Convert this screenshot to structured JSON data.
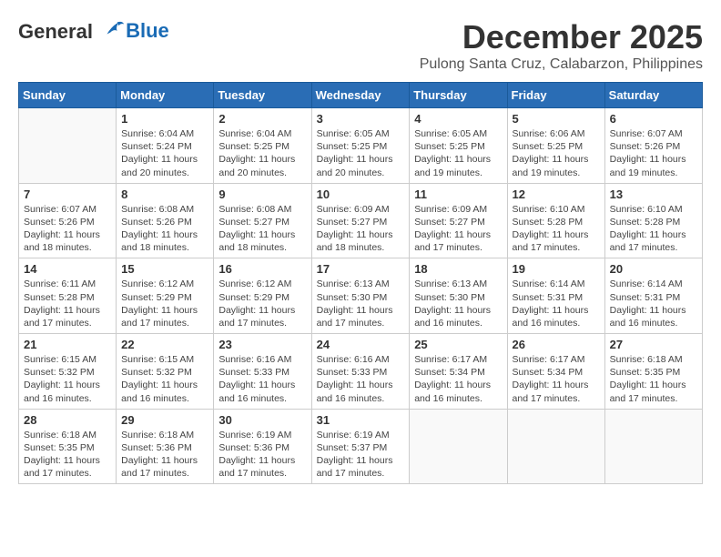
{
  "header": {
    "logo_general": "General",
    "logo_blue": "Blue",
    "month": "December 2025",
    "location": "Pulong Santa Cruz, Calabarzon, Philippines"
  },
  "days_of_week": [
    "Sunday",
    "Monday",
    "Tuesday",
    "Wednesday",
    "Thursday",
    "Friday",
    "Saturday"
  ],
  "weeks": [
    [
      {
        "day": "",
        "sunrise": "",
        "sunset": "",
        "daylight": ""
      },
      {
        "day": "1",
        "sunrise": "6:04 AM",
        "sunset": "5:24 PM",
        "daylight": "11 hours and 20 minutes."
      },
      {
        "day": "2",
        "sunrise": "6:04 AM",
        "sunset": "5:25 PM",
        "daylight": "11 hours and 20 minutes."
      },
      {
        "day": "3",
        "sunrise": "6:05 AM",
        "sunset": "5:25 PM",
        "daylight": "11 hours and 20 minutes."
      },
      {
        "day": "4",
        "sunrise": "6:05 AM",
        "sunset": "5:25 PM",
        "daylight": "11 hours and 19 minutes."
      },
      {
        "day": "5",
        "sunrise": "6:06 AM",
        "sunset": "5:25 PM",
        "daylight": "11 hours and 19 minutes."
      },
      {
        "day": "6",
        "sunrise": "6:07 AM",
        "sunset": "5:26 PM",
        "daylight": "11 hours and 19 minutes."
      }
    ],
    [
      {
        "day": "7",
        "sunrise": "6:07 AM",
        "sunset": "5:26 PM",
        "daylight": "11 hours and 18 minutes."
      },
      {
        "day": "8",
        "sunrise": "6:08 AM",
        "sunset": "5:26 PM",
        "daylight": "11 hours and 18 minutes."
      },
      {
        "day": "9",
        "sunrise": "6:08 AM",
        "sunset": "5:27 PM",
        "daylight": "11 hours and 18 minutes."
      },
      {
        "day": "10",
        "sunrise": "6:09 AM",
        "sunset": "5:27 PM",
        "daylight": "11 hours and 18 minutes."
      },
      {
        "day": "11",
        "sunrise": "6:09 AM",
        "sunset": "5:27 PM",
        "daylight": "11 hours and 17 minutes."
      },
      {
        "day": "12",
        "sunrise": "6:10 AM",
        "sunset": "5:28 PM",
        "daylight": "11 hours and 17 minutes."
      },
      {
        "day": "13",
        "sunrise": "6:10 AM",
        "sunset": "5:28 PM",
        "daylight": "11 hours and 17 minutes."
      }
    ],
    [
      {
        "day": "14",
        "sunrise": "6:11 AM",
        "sunset": "5:28 PM",
        "daylight": "11 hours and 17 minutes."
      },
      {
        "day": "15",
        "sunrise": "6:12 AM",
        "sunset": "5:29 PM",
        "daylight": "11 hours and 17 minutes."
      },
      {
        "day": "16",
        "sunrise": "6:12 AM",
        "sunset": "5:29 PM",
        "daylight": "11 hours and 17 minutes."
      },
      {
        "day": "17",
        "sunrise": "6:13 AM",
        "sunset": "5:30 PM",
        "daylight": "11 hours and 17 minutes."
      },
      {
        "day": "18",
        "sunrise": "6:13 AM",
        "sunset": "5:30 PM",
        "daylight": "11 hours and 16 minutes."
      },
      {
        "day": "19",
        "sunrise": "6:14 AM",
        "sunset": "5:31 PM",
        "daylight": "11 hours and 16 minutes."
      },
      {
        "day": "20",
        "sunrise": "6:14 AM",
        "sunset": "5:31 PM",
        "daylight": "11 hours and 16 minutes."
      }
    ],
    [
      {
        "day": "21",
        "sunrise": "6:15 AM",
        "sunset": "5:32 PM",
        "daylight": "11 hours and 16 minutes."
      },
      {
        "day": "22",
        "sunrise": "6:15 AM",
        "sunset": "5:32 PM",
        "daylight": "11 hours and 16 minutes."
      },
      {
        "day": "23",
        "sunrise": "6:16 AM",
        "sunset": "5:33 PM",
        "daylight": "11 hours and 16 minutes."
      },
      {
        "day": "24",
        "sunrise": "6:16 AM",
        "sunset": "5:33 PM",
        "daylight": "11 hours and 16 minutes."
      },
      {
        "day": "25",
        "sunrise": "6:17 AM",
        "sunset": "5:34 PM",
        "daylight": "11 hours and 16 minutes."
      },
      {
        "day": "26",
        "sunrise": "6:17 AM",
        "sunset": "5:34 PM",
        "daylight": "11 hours and 17 minutes."
      },
      {
        "day": "27",
        "sunrise": "6:18 AM",
        "sunset": "5:35 PM",
        "daylight": "11 hours and 17 minutes."
      }
    ],
    [
      {
        "day": "28",
        "sunrise": "6:18 AM",
        "sunset": "5:35 PM",
        "daylight": "11 hours and 17 minutes."
      },
      {
        "day": "29",
        "sunrise": "6:18 AM",
        "sunset": "5:36 PM",
        "daylight": "11 hours and 17 minutes."
      },
      {
        "day": "30",
        "sunrise": "6:19 AM",
        "sunset": "5:36 PM",
        "daylight": "11 hours and 17 minutes."
      },
      {
        "day": "31",
        "sunrise": "6:19 AM",
        "sunset": "5:37 PM",
        "daylight": "11 hours and 17 minutes."
      },
      {
        "day": "",
        "sunrise": "",
        "sunset": "",
        "daylight": ""
      },
      {
        "day": "",
        "sunrise": "",
        "sunset": "",
        "daylight": ""
      },
      {
        "day": "",
        "sunrise": "",
        "sunset": "",
        "daylight": ""
      }
    ]
  ]
}
